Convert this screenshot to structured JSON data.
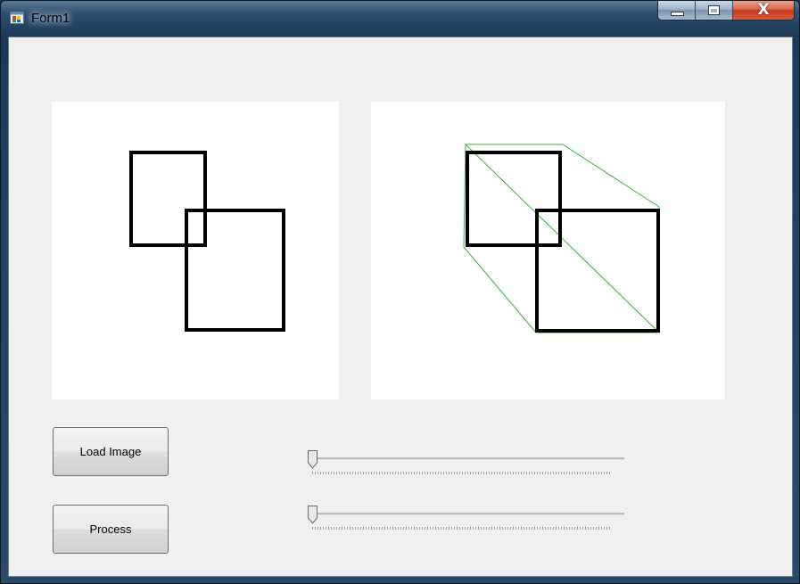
{
  "window": {
    "title": "Form1"
  },
  "caption_buttons": {
    "minimize_icon": "minimize-icon",
    "maximize_icon": "maximize-icon",
    "close_glyph": "X"
  },
  "buttons": {
    "load_image_label": "Load Image",
    "process_label": "Process"
  },
  "trackbars": [
    {
      "value": 0
    },
    {
      "value": 0
    }
  ],
  "colors": {
    "overlay_green": "#3cb43c",
    "client_background": "#f0f0f0"
  }
}
